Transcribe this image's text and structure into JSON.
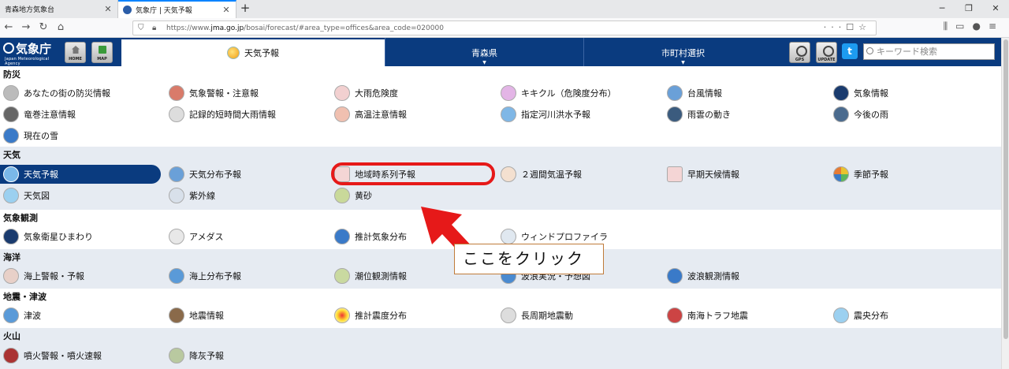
{
  "browser": {
    "tabs": [
      {
        "title": "青森地方気象台",
        "active": false
      },
      {
        "title": "気象庁 | 天気予報",
        "active": true
      }
    ],
    "url_prefix": "https://www.",
    "url_domain": "jma.go.jp",
    "url_suffix": "/bosai/forecast/#area_type=offices&area_code=020000"
  },
  "header": {
    "logo_jp": "気象庁",
    "logo_en": "Japan Meteorological Agency",
    "home_label": "HOME",
    "map_label": "MAP",
    "current_tab": "天気予報",
    "prefecture": "青森県",
    "municipality": "市町村選択",
    "gps_label": "GPS",
    "update_label": "UPDATE",
    "search_placeholder": "キーワード検索",
    "twitter_glyph": "t"
  },
  "sections": [
    {
      "title": "防災",
      "items": [
        "あなたの街の防災情報",
        "気象警報・注意報",
        "大雨危険度",
        "キキクル（危険度分布）",
        "台風情報",
        "気象情報",
        "竜巻注意情報",
        "記録的短時間大雨情報",
        "高温注意情報",
        "指定河川洪水予報",
        "雨雲の動き",
        "今後の雨",
        "現在の雪"
      ]
    },
    {
      "title": "天気",
      "items": [
        "天気予報",
        "天気分布予報",
        "地域時系列予報",
        "２週間気温予報",
        "早期天候情報",
        "季節予報",
        "天気図",
        "紫外線",
        "黄砂"
      ]
    },
    {
      "title": "気象観測",
      "items": [
        "気象衛星ひまわり",
        "アメダス",
        "推計気象分布",
        "ウィンドプロファイラ"
      ]
    },
    {
      "title": "海洋",
      "items": [
        "海上警報・予報",
        "海上分布予報",
        "潮位観測情報",
        "波浪実況・予想図",
        "波浪観測情報"
      ]
    },
    {
      "title": "地震・津波",
      "items": [
        "津波",
        "地震情報",
        "推計震度分布",
        "長周期地震動",
        "南海トラフ地震",
        "震央分布"
      ]
    },
    {
      "title": "火山",
      "items": [
        "噴火警報・噴火速報",
        "降灰予報"
      ]
    }
  ],
  "annotation": {
    "callout": "ここをクリック",
    "target": "地域時系列予報"
  },
  "colors": {
    "header_bg": "#0a3b7f",
    "selected_bg": "#0a3b7f",
    "annotation_red": "#e61919"
  }
}
